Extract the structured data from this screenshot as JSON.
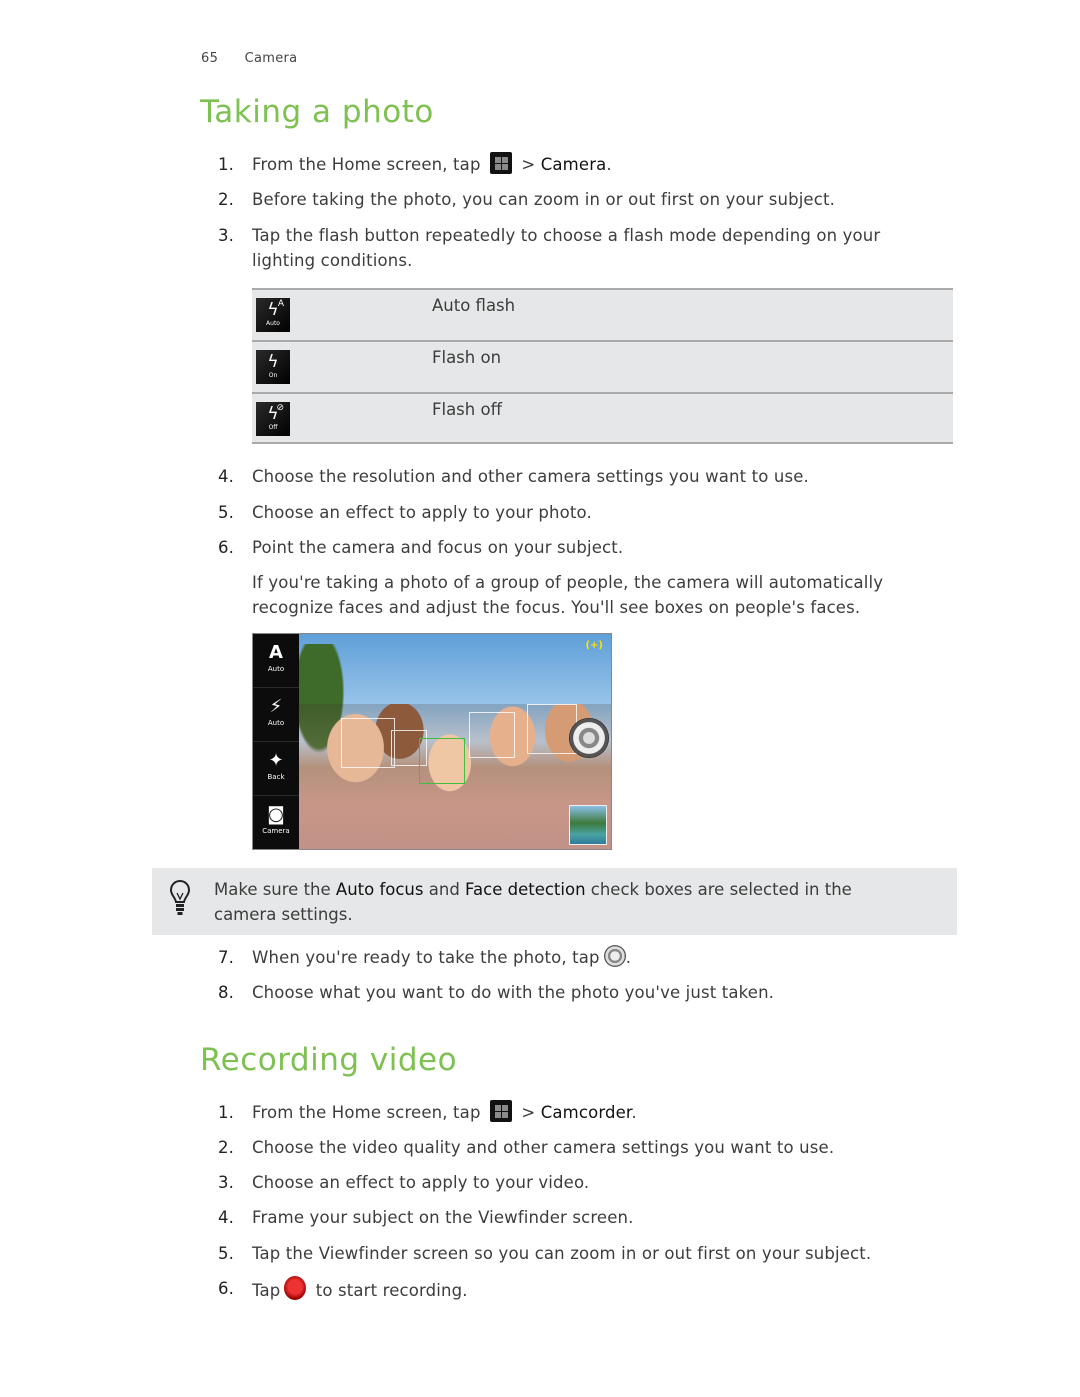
{
  "header": {
    "page_number": "65",
    "section": "Camera"
  },
  "taking_photo": {
    "title": "Taking a photo",
    "steps": [
      {
        "num": "1.",
        "pre": "From the Home screen, tap",
        "icon": "all-apps-icon",
        "sep": " > ",
        "target": "Camera",
        "post": "."
      },
      {
        "num": "2.",
        "text": "Before taking the photo, you can zoom in or out first on your subject."
      },
      {
        "num": "3.",
        "text": "Tap the flash button repeatedly to choose a flash mode depending on your lighting conditions."
      },
      {
        "num": "4.",
        "text": "Choose the resolution and other camera settings you want to use."
      },
      {
        "num": "5.",
        "text": "Choose an effect to apply to your photo."
      },
      {
        "num": "6.",
        "text": "Point the camera and focus on your subject."
      },
      {
        "num": "7.",
        "pre": "When you're ready to take the photo, tap",
        "icon": "shutter-icon",
        "post": "."
      },
      {
        "num": "8.",
        "text": "Choose what you want to do with the photo you've just taken."
      }
    ],
    "step6_note": "If you're taking a photo of a group of people, the camera will automatically recognize faces and adjust the focus. You'll see boxes on people's faces.",
    "flash_modes": [
      {
        "icon": "flash-auto-icon",
        "icon_caption": "Auto",
        "icon_sup": "A",
        "label": "Auto flash"
      },
      {
        "icon": "flash-on-icon",
        "icon_caption": "On",
        "icon_sup": "",
        "label": "Flash on"
      },
      {
        "icon": "flash-off-icon",
        "icon_caption": "Off",
        "icon_sup": "⊘",
        "label": "Flash off"
      }
    ],
    "viewfinder": {
      "buttons": [
        {
          "glyph": "A",
          "caption": "Auto"
        },
        {
          "glyph": "⚡",
          "caption": "Auto"
        },
        {
          "glyph": "✦",
          "caption": "Back"
        },
        {
          "glyph": "◙",
          "caption": "Camera"
        }
      ],
      "status_icon": "(+)"
    },
    "tip": {
      "pre": "Make sure the ",
      "term1": "Auto focus",
      "mid": " and ",
      "term2": "Face detection",
      "post": " check boxes are selected in the camera settings."
    }
  },
  "recording_video": {
    "title": "Recording video",
    "steps": [
      {
        "num": "1.",
        "pre": "From the Home screen, tap",
        "icon": "all-apps-icon",
        "sep": " > ",
        "target": "Camcorder",
        "post": "."
      },
      {
        "num": "2.",
        "text": "Choose the video quality and other camera settings you want to use."
      },
      {
        "num": "3.",
        "text": "Choose an effect to apply to your video."
      },
      {
        "num": "4.",
        "text": "Frame your subject on the Viewfinder screen."
      },
      {
        "num": "5.",
        "text": "Tap the Viewfinder screen so you can zoom in or out first on your subject."
      },
      {
        "num": "6.",
        "pre": "Tap",
        "icon": "record-icon",
        "post": " to start recording."
      }
    ]
  }
}
